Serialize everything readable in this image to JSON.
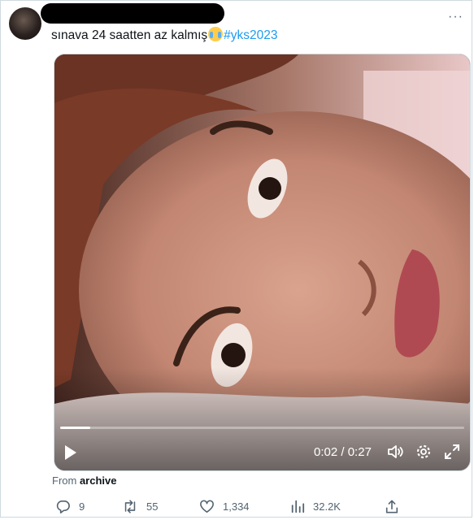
{
  "tweet": {
    "text": "sınava 24 saatten az kalmış",
    "hashtag": "#yks2023",
    "emoji": "loudly-crying-face-emoji"
  },
  "video": {
    "current_time": "0:02",
    "separator": " / ",
    "duration": "0:27",
    "progress": 0.074
  },
  "source": {
    "prefix": "From ",
    "name": "archive"
  },
  "actions": {
    "replies": "9",
    "retweets": "55",
    "likes": "1,334",
    "views": "32.2K"
  },
  "icons": [
    "more-icon",
    "play-icon",
    "volume-icon",
    "settings-icon",
    "fullscreen-icon",
    "reply-icon",
    "retweet-icon",
    "like-icon",
    "views-icon",
    "share-icon"
  ],
  "colors": {
    "link": "#1d9bf0",
    "secondary_text": "#536471"
  }
}
